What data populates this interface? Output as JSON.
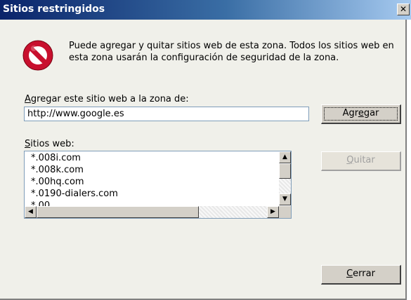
{
  "window": {
    "title": "Sitios restringidos",
    "close_glyph": "✕"
  },
  "message": {
    "icon": "restricted-icon",
    "text": "Puede agregar y quitar sitios web de esta zona. Todos los sitios web en esta zona usarán la configuración de seguridad de la zona."
  },
  "add_field": {
    "label_access": "A",
    "label_rest": "gregar este sitio web a la zona de:",
    "value": "http://www.google.es"
  },
  "buttons": {
    "add_pre": "Agr",
    "add_access": "e",
    "add_post": "gar",
    "remove_access": "Q",
    "remove_rest": "uitar",
    "close_access": "C",
    "close_rest": "errar"
  },
  "sites": {
    "label_access": "S",
    "label_rest": "itios web:",
    "items": [
      "*.008i.com",
      "*.008k.com",
      "*.00hq.com",
      "*.0190-dialers.com",
      "*.00"
    ]
  },
  "colors": {
    "title_gradient_start": "#0a246a",
    "title_gradient_end": "#a6caf0",
    "dialog_bg": "#f0f0ea",
    "disabled_text": "#a0a0a0"
  }
}
